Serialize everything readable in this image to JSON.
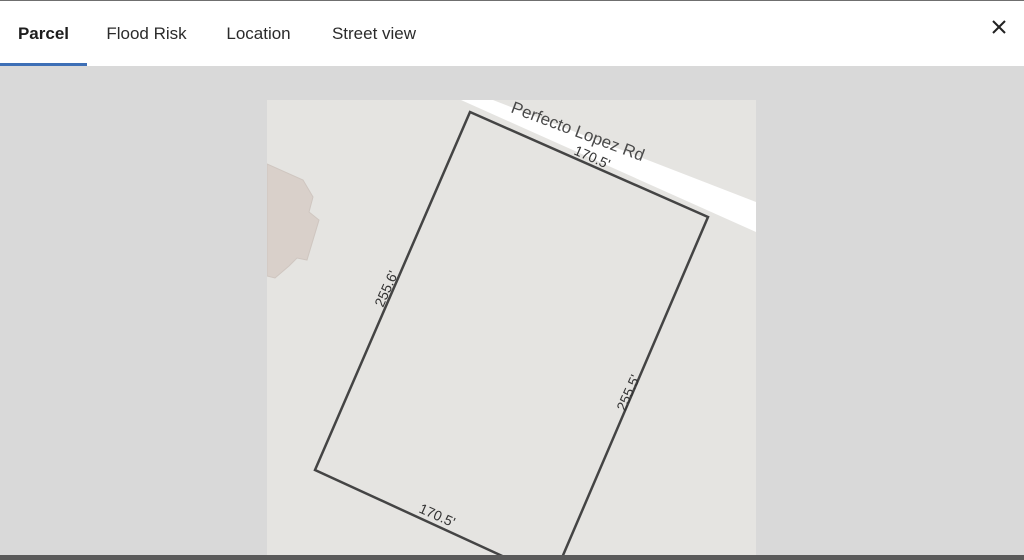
{
  "tabs": [
    {
      "label": "Parcel",
      "active": true
    },
    {
      "label": "Flood Risk",
      "active": false
    },
    {
      "label": "Location",
      "active": false
    },
    {
      "label": "Street view",
      "active": false
    }
  ],
  "close_icon": "close-icon",
  "map": {
    "street_name": "Perfecto Lopez Rd",
    "dimensions": {
      "top": "170.5'",
      "left": "255.6'",
      "right": "255.5'",
      "bottom": "170.5'"
    }
  },
  "colors": {
    "active_tab_underline": "#3d6fb6",
    "map_background": "#e5e4e1",
    "page_background": "#d9d9d9",
    "parcel_outline": "#444444",
    "building": "#d9d0ca"
  }
}
